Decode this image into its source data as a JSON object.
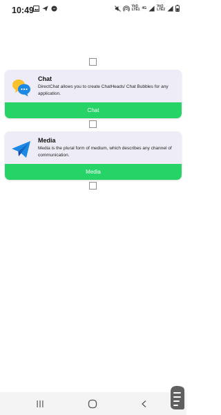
{
  "status_bar": {
    "time": "10:49",
    "network_1_top": "Vo))",
    "network_1_mid": "LTE1",
    "network_1_label": "4G",
    "network_2_top": "Vo))",
    "network_2_mid": "LTE2",
    "left_icons": [
      "image-icon",
      "send-icon",
      "messenger-icon"
    ],
    "right_icons": [
      "mute-icon",
      "hotspot-icon",
      "signal-icon",
      "signal-icon",
      "battery-icon"
    ]
  },
  "cards": [
    {
      "title": "Chat",
      "description": "DirectChat allows you to create ChatHeads/ Chat Bubbles for any application.",
      "button_label": "Chat",
      "icon": "chat-bubbles-icon"
    },
    {
      "title": "Media",
      "description": "Media is the plural form of medium, which describes any channel of communication.",
      "button_label": "Media",
      "icon": "telegram-icon"
    }
  ],
  "colors": {
    "accent": "#26d366",
    "card_bg": "#eeedf7",
    "chat_blue": "#1e88e5",
    "chat_yellow": "#fbc02d",
    "telegram_blue": "#1e88e5"
  },
  "nav": [
    "recents-icon",
    "home-icon",
    "back-icon"
  ]
}
